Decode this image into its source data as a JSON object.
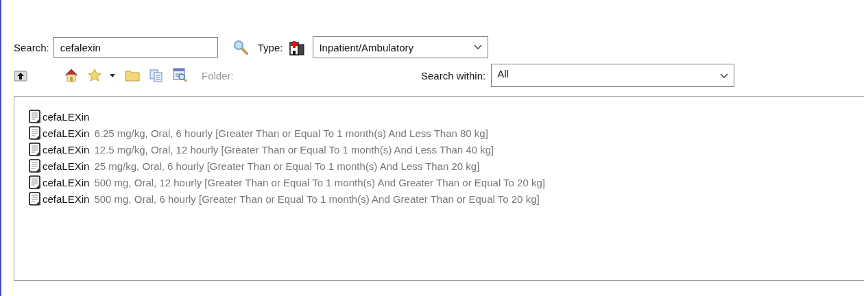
{
  "search": {
    "label": "Search:",
    "value": "cefalexin"
  },
  "type": {
    "label": "Type:",
    "value": "Inpatient/Ambulatory"
  },
  "toolbar": {
    "folder_label": "Folder:",
    "search_within_label": "Search within:",
    "search_within_value": "All"
  },
  "results": [
    {
      "name": "cefaLEXin"
    },
    {
      "name": "cefaLEXin",
      "detail": "6.25 mg/kg, Oral, 6 hourly [Greater Than or Equal To 1 month(s) And Less Than 80 kg]"
    },
    {
      "name": "cefaLEXin",
      "detail": "12.5 mg/kg, Oral, 12 hourly [Greater Than or Equal To 1 month(s) And Less Than 40 kg]"
    },
    {
      "name": "cefaLEXin",
      "detail": "25 mg/kg, Oral, 6 hourly [Greater Than or Equal To 1 month(s) And Less Than 20 kg]"
    },
    {
      "name": "cefaLEXin",
      "detail": "500 mg, Oral, 12 hourly [Greater Than or Equal To 1 month(s) And Greater Than or Equal To 20 kg]"
    },
    {
      "name": "cefaLEXin",
      "detail": "500 mg, Oral, 6 hourly [Greater Than or Equal To 1 month(s) And Greater Than or Equal To 20 kg]"
    }
  ]
}
